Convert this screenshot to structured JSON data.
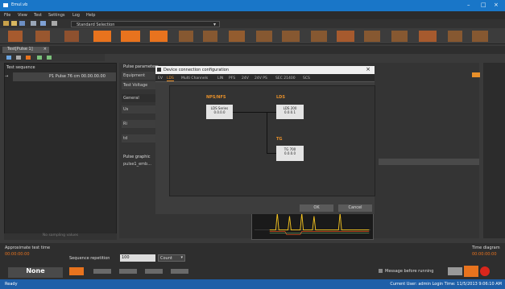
{
  "window": {
    "title": "Emul.vb",
    "minimize": "–",
    "maximize": "□",
    "close": "×"
  },
  "menu": [
    "File",
    "View",
    "Test",
    "Settings",
    "Log",
    "Help"
  ],
  "toolbar": {
    "standard_selection": "Standard Selection",
    "toolbar_icons": [
      "new-icon",
      "open-icon",
      "save-icon",
      "settings-icon",
      "info-icon",
      "print-icon"
    ]
  },
  "doc_tab": {
    "label": "Test[Pulse 1]",
    "close": "×"
  },
  "left_panel": {
    "header": "Test sequence",
    "item_marker": "→",
    "item_label": "P1 Pulse 76 cm 00.00.00.00",
    "footer": "No sampling values"
  },
  "center_panel": {
    "param_title": "Pulse parameters",
    "rows": [
      "Equipment",
      "Test Voltage",
      "General",
      "Us",
      "Ri",
      "td"
    ],
    "pulse_graphic": "Pulse graphic",
    "pulse_sub": "pulse1_emb..."
  },
  "dialog": {
    "title": "Device connection configuration",
    "close": "×",
    "tabs": [
      "EV",
      "LDS",
      "Multi Channels",
      "LIN",
      "PFS",
      "24V",
      "24V PS",
      "SEC 21400",
      "SCS"
    ],
    "active_tab": "LDS",
    "devices": {
      "left_label": "NPS/NFS",
      "left_name": "LDS Series",
      "left_ver": "0.0.0.0",
      "right1_label": "LDS",
      "right1_name": "LDS 200",
      "right1_ver": "0.0.0.1",
      "right2_label": "TG",
      "right2_name": "TG 700",
      "right2_ver": "0.0.0.0"
    },
    "ok": "OK",
    "cancel": "Cancel"
  },
  "bottom": {
    "approx_label": "Approximate test time",
    "approx_value": "00:00:00:00",
    "seq_rep_label": "Sequence repetition",
    "seq_rep_value": "100",
    "count_label": "Count",
    "msg_before": "Message before running",
    "none_btn": "None",
    "right_label": "Time diagram",
    "right_value": "00:00:00:00"
  },
  "status": {
    "left": "Ready",
    "right": "Current User: admin  Login Time: 11/5/2013 9:06:10 AM"
  },
  "colors": {
    "accent": "#e8731e",
    "titlebar": "#1976c8",
    "status": "#1e5fa8"
  }
}
